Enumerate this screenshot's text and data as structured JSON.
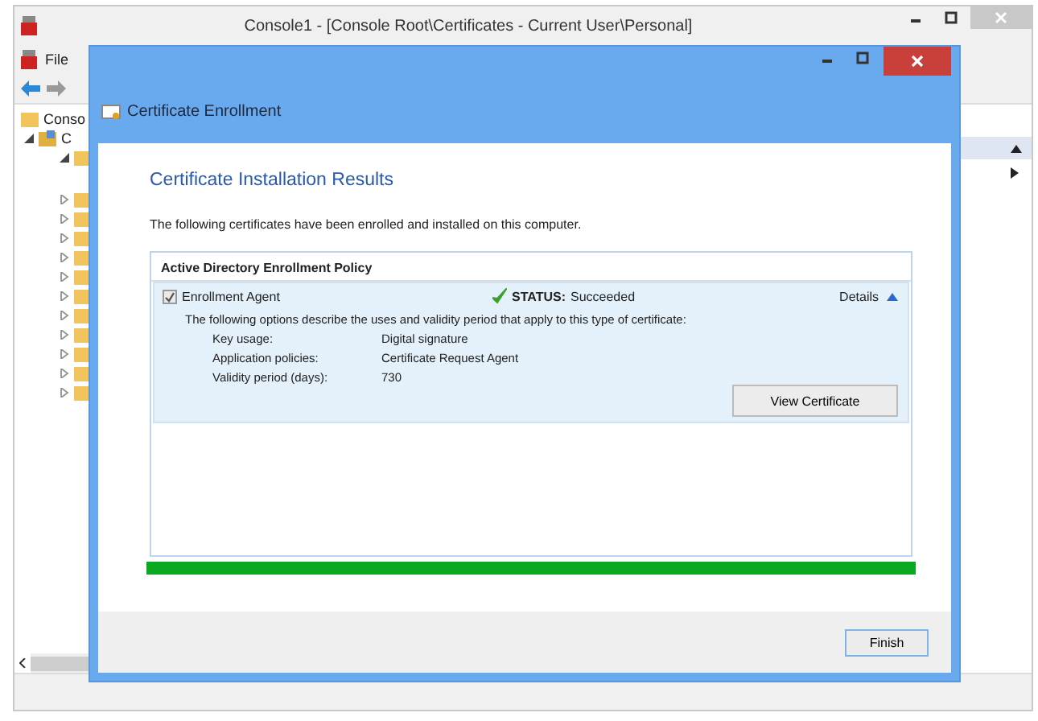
{
  "console": {
    "title": "Console1 - [Console Root\\Certificates - Current User\\Personal]",
    "menu": [
      "File"
    ],
    "tree": [
      {
        "label": "Conso",
        "children": [
          {
            "label": "C",
            "expanded": true,
            "children": [
              {
                "expanded": true
              },
              {
                "expanded": false
              },
              {
                "expanded": false
              },
              {
                "expanded": false
              },
              {
                "expanded": false
              },
              {
                "expanded": false
              },
              {
                "expanded": false
              },
              {
                "expanded": false
              },
              {
                "expanded": false
              },
              {
                "expanded": false
              },
              {
                "expanded": false
              },
              {
                "expanded": false
              }
            ]
          }
        ]
      }
    ]
  },
  "dialog": {
    "title": "Certificate Enrollment",
    "heading": "Certificate Installation Results",
    "intro": "The following certificates have been enrolled and installed on this computer.",
    "policy": "Active Directory Enrollment Policy",
    "certificates": [
      {
        "name": "Enrollment Agent",
        "checked": true,
        "status_label": "STATUS:",
        "status": "Succeeded",
        "details": "Details",
        "expanded": true,
        "description": "The following options describe the uses and validity period that apply to this type of certificate:",
        "properties": [
          {
            "key": "Key usage:",
            "value": "Digital signature"
          },
          {
            "key": "Application policies:",
            "value": "Certificate Request Agent"
          },
          {
            "key": "Validity period (days):",
            "value": "730"
          }
        ],
        "button": "View Certificate"
      }
    ],
    "progress": {
      "level": 1
    },
    "buttons": [
      "Finish"
    ]
  }
}
